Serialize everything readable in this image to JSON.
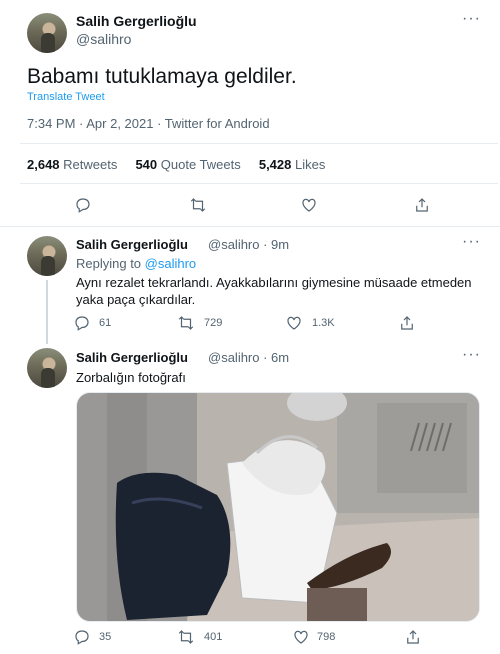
{
  "main_tweet": {
    "author_name": "Salih Gergerlioğlu",
    "author_handle": "@salihro",
    "text": "Babamı tutuklamaya geldiler.",
    "translate_label": "Translate Tweet",
    "meta": "7:34 PM · Apr 2, 2021 · Twitter for Android",
    "retweets_count": "2,648",
    "retweets_label": "Retweets",
    "quotes_count": "540",
    "quotes_label": "Quote Tweets",
    "likes_count": "5,428",
    "likes_label": "Likes",
    "more_label": "···"
  },
  "reply1": {
    "author_name": "Salih Gergerlioğlu",
    "author_handle": "@salihro · 9m",
    "replying_prefix": "Replying to",
    "replying_to": "@salihro",
    "text": "Aynı rezalet tekrarlandı. Ayakkabılarını giymesine müsaade etmeden yaka paça çıkardılar.",
    "reply_count": "61",
    "retweet_count": "729",
    "like_count": "1.3K",
    "more_label": "···"
  },
  "reply2": {
    "author_name": "Salih Gergerlioğlu",
    "author_handle": "@salihro · 6m",
    "text": "Zorbalığın fotoğrafı",
    "reply_count": "35",
    "retweet_count": "401",
    "like_count": "798",
    "more_label": "···"
  },
  "colors": {
    "link": "#1d9bf0",
    "muted": "#536471",
    "text": "#0f1419",
    "border": "#e6ecf0"
  },
  "icons": [
    "reply-icon",
    "retweet-icon",
    "like-icon",
    "share-icon",
    "more-icon"
  ]
}
